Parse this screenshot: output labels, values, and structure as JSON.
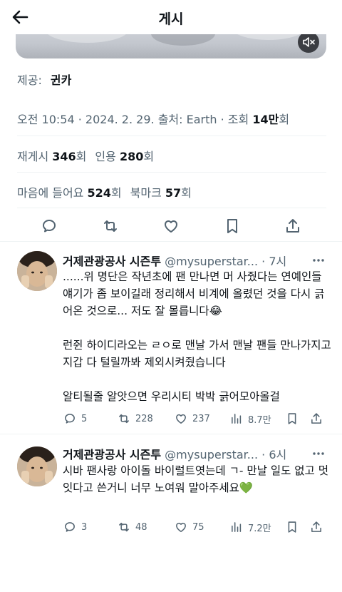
{
  "header": {
    "title": "게시"
  },
  "source": {
    "label": "제공:",
    "value": "귄카"
  },
  "meta": {
    "time": "오전 10:54",
    "date": "2024. 2. 29.",
    "source_label": "출처:",
    "source_value": "Earth",
    "views_label": "조회",
    "views_value": "14만",
    "views_suffix": "회"
  },
  "stats": {
    "reposts_label": "재게시",
    "reposts_value": "346",
    "reposts_suffix": "회",
    "quotes_label": "인용",
    "quotes_value": "280",
    "quotes_suffix": "회",
    "likes_label": "마음에 들어요",
    "likes_value": "524",
    "likes_suffix": "회",
    "bookmarks_label": "북마크",
    "bookmarks_value": "57",
    "bookmarks_suffix": "회"
  },
  "icons": {
    "back": "back-arrow-icon",
    "mute": "speaker-muted-icon",
    "reply": "reply-bubble-icon",
    "repost": "repost-icon",
    "like": "heart-icon",
    "bookmark": "bookmark-icon",
    "share": "share-icon",
    "more": "more-dots-icon",
    "views": "views-bar-icon"
  },
  "colors": {
    "text": "#0f1419",
    "secondary": "#536471",
    "divider": "#eff3f4"
  },
  "replies": [
    {
      "name": "거제관광공사 시즌투",
      "handle": "@mysuperstar...",
      "time": "7시",
      "paragraphs": [
        "......위 명단은 작년초에 팬 만나면 머 사줬다는 연예인들 얘기가 좀 보이길래 정리해서 비계에 올렸던 것을 다시 긁어온 것으로... 저도 잘 몰릅니다😂",
        "런쥔 하이디라오는 ㄹㅇ로 맨날 가서 맨날 팬들 만나가지고 지갑 다 털릴까봐 제외시켜줬습니다",
        "알티될줄 알앗으면 우리시티 박박 긁어모아올걸"
      ],
      "replies": "5",
      "reposts": "228",
      "likes": "237",
      "views": "8.7만"
    },
    {
      "name": "거제관광공사 시즌투",
      "handle": "@mysuperstar...",
      "time": "6시",
      "paragraphs": [
        "시바 팬사랑 아이돌 바이럴트엿는데 ㄱ- 만날 일도 없고 멋잇다고 쓴거니 너무 노여워 말아주세요💚"
      ],
      "replies": "3",
      "reposts": "48",
      "likes": "75",
      "views": "7.2만"
    }
  ]
}
